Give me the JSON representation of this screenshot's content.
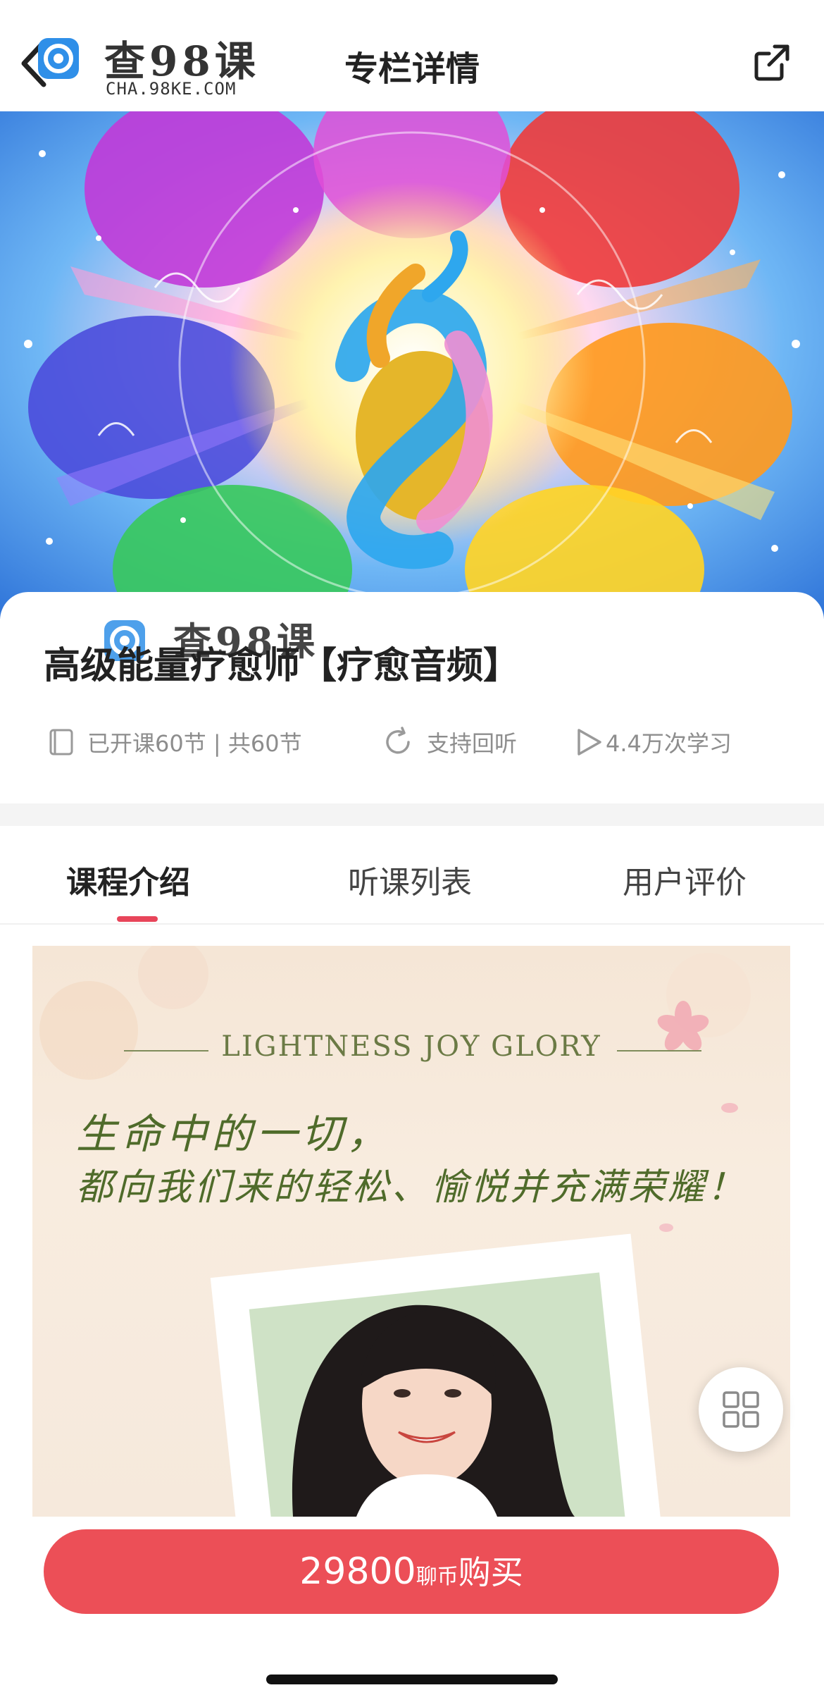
{
  "nav": {
    "title": "专栏详情",
    "watermark_text": "查98课",
    "watermark_sub": "CHA.98KE.COM"
  },
  "course": {
    "title": "高级能量疗愈师【疗愈音频】",
    "lessons": "已开课60节 | 共60节",
    "replay": "支持回听",
    "learners": "4.4万次学习"
  },
  "tabs": [
    {
      "label": "课程介绍",
      "active": true
    },
    {
      "label": "听课列表",
      "active": false
    },
    {
      "label": "用户评价",
      "active": false
    }
  ],
  "intro_image": {
    "heading": "LIGHTNESS JOY GLORY",
    "quote_line1": "生命中的一切，",
    "quote_line2": "都向我们来的轻松、愉悦并充满荣耀！"
  },
  "buy": {
    "amount": "29800",
    "unit": "聊币",
    "action": "购买"
  },
  "colors": {
    "accent": "#ec4f57",
    "tab_indicator": "#e8455a",
    "quote_green": "#4f6b2a"
  }
}
